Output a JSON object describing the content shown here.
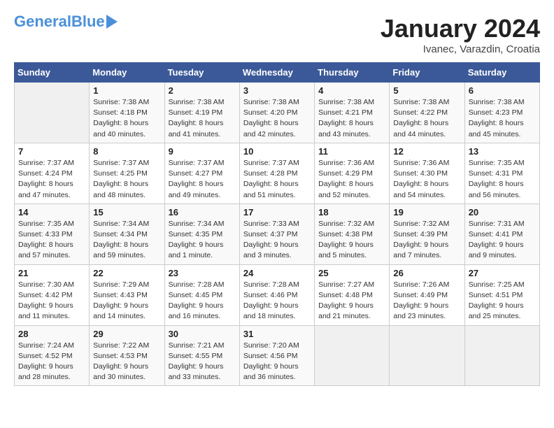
{
  "header": {
    "logo_general": "General",
    "logo_blue": "Blue",
    "month": "January 2024",
    "location": "Ivanec, Varazdin, Croatia"
  },
  "weekdays": [
    "Sunday",
    "Monday",
    "Tuesday",
    "Wednesday",
    "Thursday",
    "Friday",
    "Saturday"
  ],
  "weeks": [
    [
      {
        "day": "",
        "info": ""
      },
      {
        "day": "1",
        "info": "Sunrise: 7:38 AM\nSunset: 4:18 PM\nDaylight: 8 hours\nand 40 minutes."
      },
      {
        "day": "2",
        "info": "Sunrise: 7:38 AM\nSunset: 4:19 PM\nDaylight: 8 hours\nand 41 minutes."
      },
      {
        "day": "3",
        "info": "Sunrise: 7:38 AM\nSunset: 4:20 PM\nDaylight: 8 hours\nand 42 minutes."
      },
      {
        "day": "4",
        "info": "Sunrise: 7:38 AM\nSunset: 4:21 PM\nDaylight: 8 hours\nand 43 minutes."
      },
      {
        "day": "5",
        "info": "Sunrise: 7:38 AM\nSunset: 4:22 PM\nDaylight: 8 hours\nand 44 minutes."
      },
      {
        "day": "6",
        "info": "Sunrise: 7:38 AM\nSunset: 4:23 PM\nDaylight: 8 hours\nand 45 minutes."
      }
    ],
    [
      {
        "day": "7",
        "info": "Sunrise: 7:37 AM\nSunset: 4:24 PM\nDaylight: 8 hours\nand 47 minutes."
      },
      {
        "day": "8",
        "info": "Sunrise: 7:37 AM\nSunset: 4:25 PM\nDaylight: 8 hours\nand 48 minutes."
      },
      {
        "day": "9",
        "info": "Sunrise: 7:37 AM\nSunset: 4:27 PM\nDaylight: 8 hours\nand 49 minutes."
      },
      {
        "day": "10",
        "info": "Sunrise: 7:37 AM\nSunset: 4:28 PM\nDaylight: 8 hours\nand 51 minutes."
      },
      {
        "day": "11",
        "info": "Sunrise: 7:36 AM\nSunset: 4:29 PM\nDaylight: 8 hours\nand 52 minutes."
      },
      {
        "day": "12",
        "info": "Sunrise: 7:36 AM\nSunset: 4:30 PM\nDaylight: 8 hours\nand 54 minutes."
      },
      {
        "day": "13",
        "info": "Sunrise: 7:35 AM\nSunset: 4:31 PM\nDaylight: 8 hours\nand 56 minutes."
      }
    ],
    [
      {
        "day": "14",
        "info": "Sunrise: 7:35 AM\nSunset: 4:33 PM\nDaylight: 8 hours\nand 57 minutes."
      },
      {
        "day": "15",
        "info": "Sunrise: 7:34 AM\nSunset: 4:34 PM\nDaylight: 8 hours\nand 59 minutes."
      },
      {
        "day": "16",
        "info": "Sunrise: 7:34 AM\nSunset: 4:35 PM\nDaylight: 9 hours\nand 1 minute."
      },
      {
        "day": "17",
        "info": "Sunrise: 7:33 AM\nSunset: 4:37 PM\nDaylight: 9 hours\nand 3 minutes."
      },
      {
        "day": "18",
        "info": "Sunrise: 7:32 AM\nSunset: 4:38 PM\nDaylight: 9 hours\nand 5 minutes."
      },
      {
        "day": "19",
        "info": "Sunrise: 7:32 AM\nSunset: 4:39 PM\nDaylight: 9 hours\nand 7 minutes."
      },
      {
        "day": "20",
        "info": "Sunrise: 7:31 AM\nSunset: 4:41 PM\nDaylight: 9 hours\nand 9 minutes."
      }
    ],
    [
      {
        "day": "21",
        "info": "Sunrise: 7:30 AM\nSunset: 4:42 PM\nDaylight: 9 hours\nand 11 minutes."
      },
      {
        "day": "22",
        "info": "Sunrise: 7:29 AM\nSunset: 4:43 PM\nDaylight: 9 hours\nand 14 minutes."
      },
      {
        "day": "23",
        "info": "Sunrise: 7:28 AM\nSunset: 4:45 PM\nDaylight: 9 hours\nand 16 minutes."
      },
      {
        "day": "24",
        "info": "Sunrise: 7:28 AM\nSunset: 4:46 PM\nDaylight: 9 hours\nand 18 minutes."
      },
      {
        "day": "25",
        "info": "Sunrise: 7:27 AM\nSunset: 4:48 PM\nDaylight: 9 hours\nand 21 minutes."
      },
      {
        "day": "26",
        "info": "Sunrise: 7:26 AM\nSunset: 4:49 PM\nDaylight: 9 hours\nand 23 minutes."
      },
      {
        "day": "27",
        "info": "Sunrise: 7:25 AM\nSunset: 4:51 PM\nDaylight: 9 hours\nand 25 minutes."
      }
    ],
    [
      {
        "day": "28",
        "info": "Sunrise: 7:24 AM\nSunset: 4:52 PM\nDaylight: 9 hours\nand 28 minutes."
      },
      {
        "day": "29",
        "info": "Sunrise: 7:22 AM\nSunset: 4:53 PM\nDaylight: 9 hours\nand 30 minutes."
      },
      {
        "day": "30",
        "info": "Sunrise: 7:21 AM\nSunset: 4:55 PM\nDaylight: 9 hours\nand 33 minutes."
      },
      {
        "day": "31",
        "info": "Sunrise: 7:20 AM\nSunset: 4:56 PM\nDaylight: 9 hours\nand 36 minutes."
      },
      {
        "day": "",
        "info": ""
      },
      {
        "day": "",
        "info": ""
      },
      {
        "day": "",
        "info": ""
      }
    ]
  ]
}
